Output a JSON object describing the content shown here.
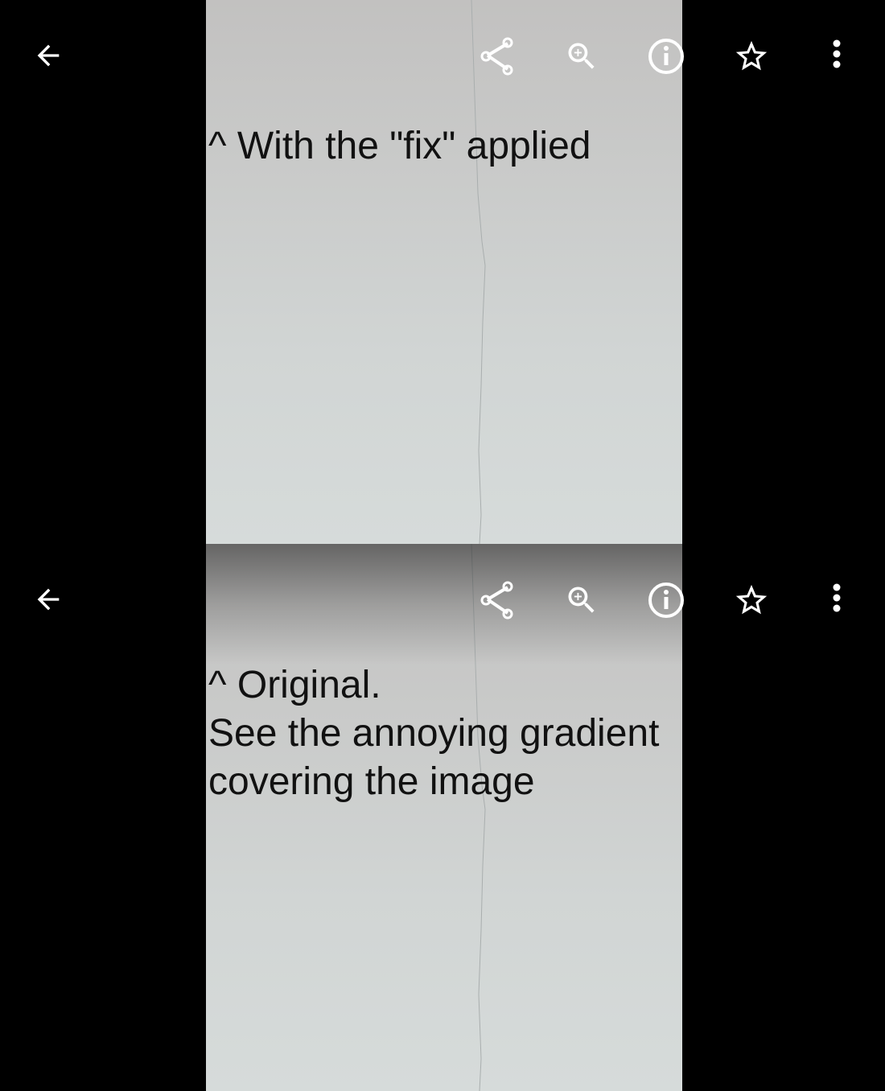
{
  "screens": [
    {
      "caption": "^ With the \"fix\" applied",
      "toolbar": {
        "back_icon": "arrow-back-icon",
        "actions": [
          "share-icon",
          "zoom-in-icon",
          "info-icon",
          "star-outline-icon",
          "more-vert-icon"
        ]
      }
    },
    {
      "caption": "^ Original.\nSee the annoying gradient\ncovering the image",
      "toolbar": {
        "back_icon": "arrow-back-icon",
        "actions": [
          "share-icon",
          "zoom-in-icon",
          "info-icon",
          "star-outline-icon",
          "more-vert-icon"
        ]
      }
    }
  ],
  "colors": {
    "background": "#000000",
    "icon": "#ffffff",
    "caption_text": "#111111",
    "photo_top": "#c2c1c0",
    "photo_bottom": "#d6dbda"
  }
}
